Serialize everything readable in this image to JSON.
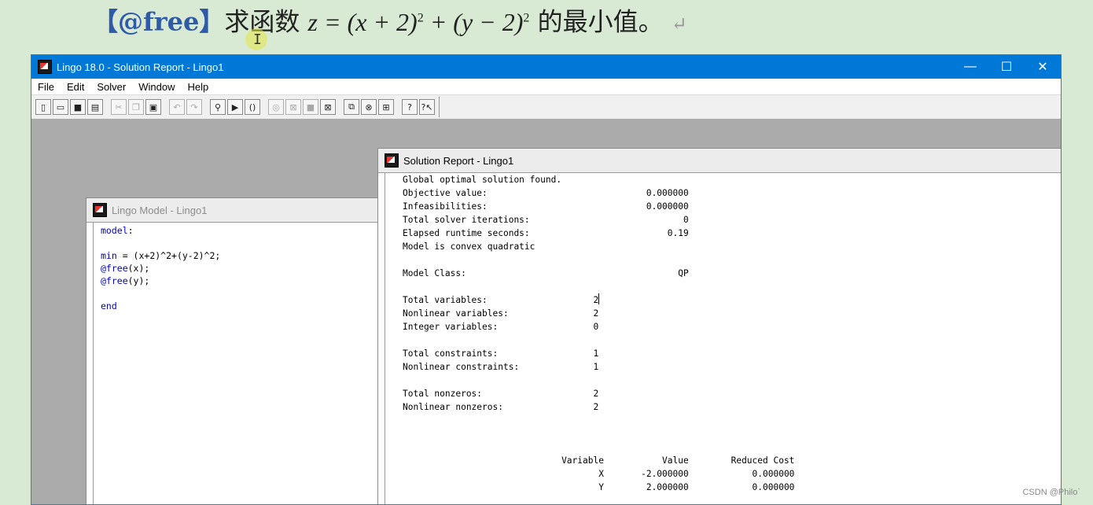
{
  "headline": {
    "tag": "【@free】",
    "text": "求函数",
    "formula_a": "z = (x + 2)",
    "exp_a": "2",
    "formula_b": " + (y − 2)",
    "exp_b": "2",
    "tail": " 的最小值。",
    "return_mark": "↵"
  },
  "app": {
    "title": "Lingo 18.0 - Solution Report - Lingo1",
    "window_controls": {
      "minimize": "—",
      "maximize": "☐",
      "close": "✕"
    },
    "menu": [
      "File",
      "Edit",
      "Solver",
      "Window",
      "Help"
    ],
    "toolbar_groups": [
      [
        "new-icon",
        "open-icon",
        "save-icon",
        "print-icon"
      ],
      [
        "cut-icon",
        "copy-icon",
        "paste-icon"
      ],
      [
        "undo-icon",
        "redo-icon"
      ],
      [
        "find-icon",
        "goto-icon",
        "match-paren-icon"
      ],
      [
        "solve-icon",
        "solution-icon",
        "send-to-back-icon",
        "close-all-icon"
      ],
      [
        "tile-icon",
        "cascade-icon",
        "arrange-icon"
      ],
      [
        "help-icon",
        "context-help-icon"
      ]
    ]
  },
  "model_window": {
    "title": "Lingo Model - Lingo1",
    "lines": [
      {
        "kw": "model",
        "rest": ":"
      },
      {
        "kw": "",
        "rest": ""
      },
      {
        "kw": "min",
        "rest": " = (x+2)^2+(y-2)^2;"
      },
      {
        "kw": "@free",
        "rest": "(x);"
      },
      {
        "kw": "@free",
        "rest": "(y);"
      },
      {
        "kw": "",
        "rest": ""
      },
      {
        "kw": "end",
        "rest": ""
      }
    ]
  },
  "report_window": {
    "title": "Solution Report - Lingo1",
    "summary": [
      "Global optimal solution found.",
      "Objective value:                              0.000000",
      "Infeasibilities:                              0.000000",
      "Total solver iterations:                             0",
      "Elapsed runtime seconds:                          0.19",
      "Model is convex quadratic",
      "",
      "Model Class:                                        QP",
      "",
      "Total variables:                    2",
      "Nonlinear variables:                2",
      "Integer variables:                  0",
      "",
      "Total constraints:                  1",
      "Nonlinear constraints:              1",
      "",
      "Total nonzeros:                     2",
      "Nonlinear nonzeros:                 2",
      "",
      "",
      "",
      "                              Variable           Value        Reduced Cost",
      "                                     X       -2.000000            0.000000",
      "                                     Y        2.000000            0.000000"
    ]
  },
  "watermark": "CSDN @Philo`"
}
